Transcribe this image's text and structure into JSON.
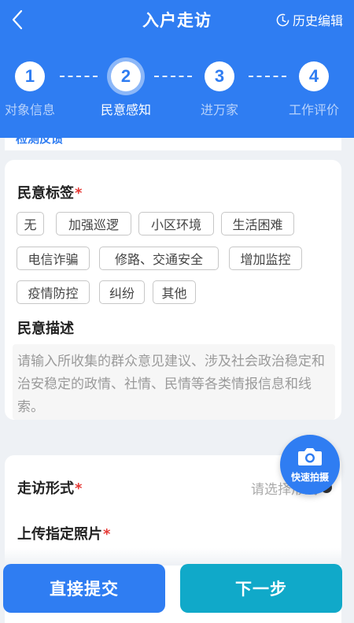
{
  "header": {
    "title": "入户走访",
    "history_label": "历史编辑",
    "accent_color": "#2f7df2"
  },
  "steps": [
    {
      "number": "1",
      "label": "对象信息",
      "active": false
    },
    {
      "number": "2",
      "label": "民意感知",
      "active": true
    },
    {
      "number": "3",
      "label": "进万家",
      "active": false
    },
    {
      "number": "4",
      "label": "工作评价",
      "active": false
    }
  ],
  "peek_section": {
    "title": "检测反馈"
  },
  "opinion_tags": {
    "title": "民意标签",
    "required_mark": "*",
    "tags": [
      "无",
      "加强巡逻",
      "小区环境",
      "生活困难",
      "电信诈骗",
      "修路、交通安全",
      "增加监控",
      "疫情防控",
      "纠纷",
      "其他"
    ]
  },
  "opinion_desc": {
    "title": "民意描述",
    "placeholder": "请输入所收集的群众意见建议、涉及社会政治稳定和治安稳定的政情、社情、民情等各类情报信息和线索。"
  },
  "visit_form": {
    "label": "走访形式",
    "required_mark": "*",
    "placeholder": "请选择形式"
  },
  "upload_photos": {
    "label": "上传指定照片",
    "required_mark": "*"
  },
  "fab": {
    "label": "快速拍摄",
    "icon": "camera-icon"
  },
  "actions": {
    "submit_label": "直接提交",
    "next_label": "下一步",
    "submit_color": "#2f7df2",
    "next_color": "#10a9c9"
  }
}
